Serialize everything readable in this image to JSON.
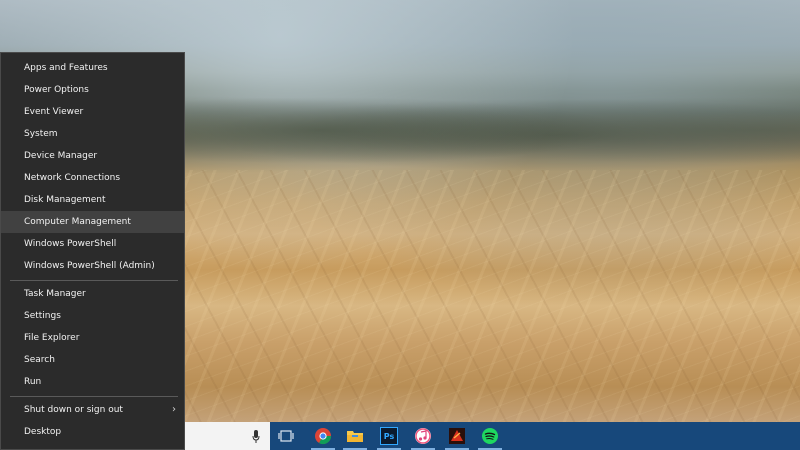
{
  "menu": {
    "items": [
      {
        "label": "Apps and Features"
      },
      {
        "label": "Power Options"
      },
      {
        "label": "Event Viewer"
      },
      {
        "label": "System"
      },
      {
        "label": "Device Manager"
      },
      {
        "label": "Network Connections"
      },
      {
        "label": "Disk Management"
      },
      {
        "label": "Computer Management",
        "highlighted": true
      },
      {
        "label": "Windows PowerShell"
      },
      {
        "label": "Windows PowerShell (Admin)"
      },
      {
        "label": "Task Manager"
      },
      {
        "label": "Settings"
      },
      {
        "label": "File Explorer"
      },
      {
        "label": "Search"
      },
      {
        "label": "Run"
      },
      {
        "label": "Shut down or sign out",
        "submenu_arrow": "›"
      },
      {
        "label": "Desktop"
      }
    ]
  },
  "taskbar": {
    "search_box_placeholder": "",
    "icons": [
      {
        "name": "microphone-icon"
      },
      {
        "name": "task-view-icon"
      },
      {
        "name": "chrome-icon",
        "active": true
      },
      {
        "name": "file-explorer-icon",
        "active": true
      },
      {
        "name": "photoshop-icon",
        "label": "Ps",
        "active": true
      },
      {
        "name": "itunes-icon",
        "active": true
      },
      {
        "name": "red-game-icon",
        "active": true
      },
      {
        "name": "spotify-icon",
        "active": true
      }
    ],
    "colors": {
      "bar": "#17487b",
      "accent_underline": "#7fb0e0"
    }
  },
  "colors": {
    "menu_bg": "#2b2b2b",
    "menu_highlight": "#414141",
    "menu_text": "#f2f2f2"
  }
}
